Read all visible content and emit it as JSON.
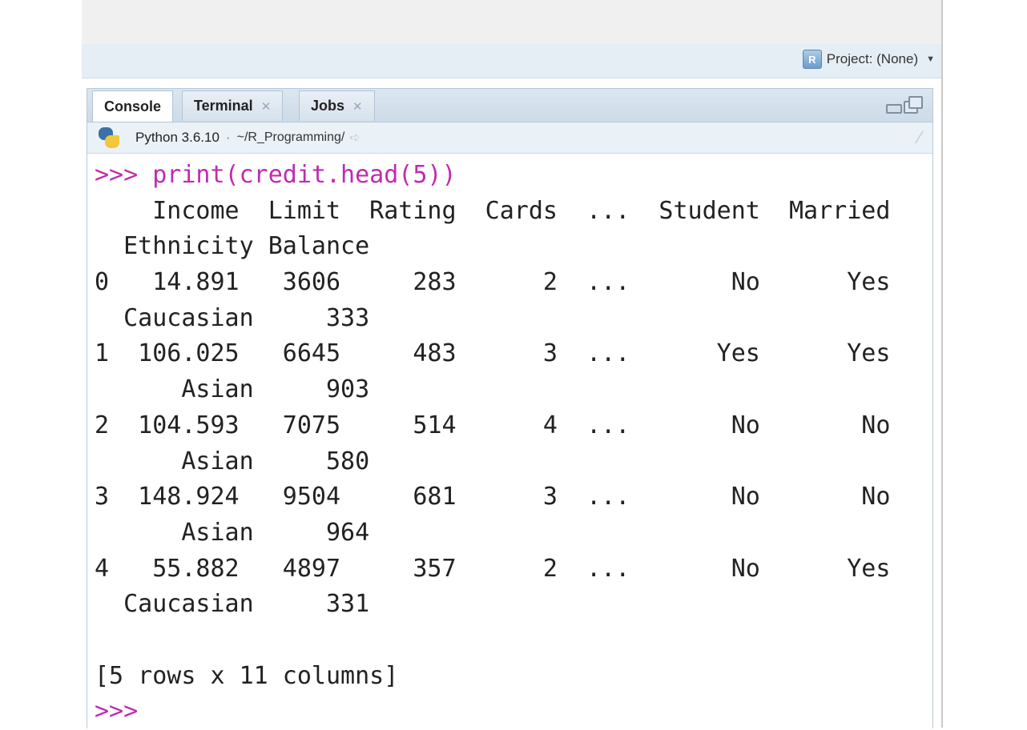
{
  "project": {
    "label": "Project: (None)"
  },
  "tabs": [
    {
      "label": "Console",
      "active": true,
      "closable": false
    },
    {
      "label": "Terminal",
      "active": false,
      "closable": true
    },
    {
      "label": "Jobs",
      "active": false,
      "closable": true
    }
  ],
  "pathbar": {
    "interpreter": "Python 3.6.10",
    "path": "~/R_Programming/"
  },
  "console": {
    "prompt": ">>>",
    "command": "print(credit.head(5))",
    "output_lines": [
      "    Income  Limit  Rating  Cards  ...  Student  Married",
      "  Ethnicity Balance",
      "0   14.891   3606     283      2  ...       No      Yes",
      "  Caucasian     333",
      "1  106.025   6645     483      3  ...      Yes      Yes",
      "      Asian     903",
      "2  104.593   7075     514      4  ...       No       No",
      "      Asian     580",
      "3  148.924   9504     681      3  ...       No       No",
      "      Asian     964",
      "4   55.882   4897     357      2  ...       No      Yes",
      "  Caucasian     331",
      "",
      "[5 rows x 11 columns]"
    ],
    "final_prompt": ">>>"
  },
  "colors": {
    "command": "#c02bb0",
    "pane_border": "#b7c8d8",
    "tabbar_bg": "#d3e0eb"
  },
  "icons": [
    "project-icon",
    "close-icon",
    "minimize-icon",
    "maximize-icon",
    "python-icon",
    "goto-directory-icon",
    "clear-console-icon"
  ]
}
